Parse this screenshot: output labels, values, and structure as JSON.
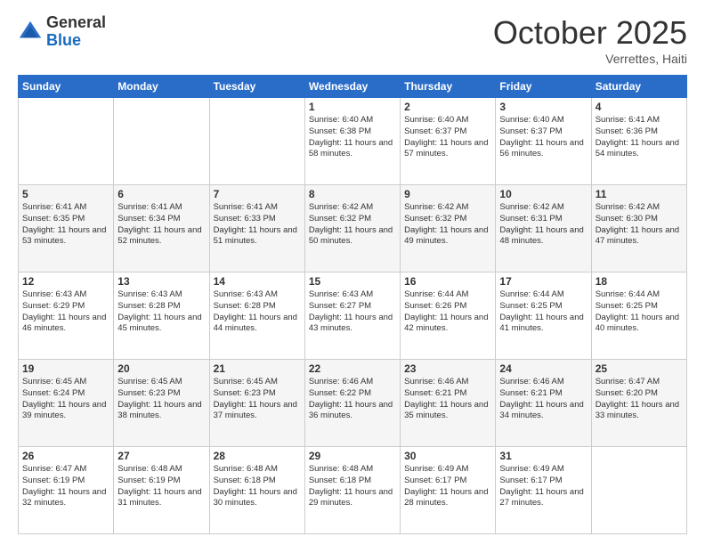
{
  "header": {
    "logo_general": "General",
    "logo_blue": "Blue",
    "month_title": "October 2025",
    "location": "Verrettes, Haiti"
  },
  "weekdays": [
    "Sunday",
    "Monday",
    "Tuesday",
    "Wednesday",
    "Thursday",
    "Friday",
    "Saturday"
  ],
  "weeks": [
    [
      {
        "day": "",
        "sunrise": "",
        "sunset": "",
        "daylight": ""
      },
      {
        "day": "",
        "sunrise": "",
        "sunset": "",
        "daylight": ""
      },
      {
        "day": "",
        "sunrise": "",
        "sunset": "",
        "daylight": ""
      },
      {
        "day": "1",
        "sunrise": "Sunrise: 6:40 AM",
        "sunset": "Sunset: 6:38 PM",
        "daylight": "Daylight: 11 hours and 58 minutes."
      },
      {
        "day": "2",
        "sunrise": "Sunrise: 6:40 AM",
        "sunset": "Sunset: 6:37 PM",
        "daylight": "Daylight: 11 hours and 57 minutes."
      },
      {
        "day": "3",
        "sunrise": "Sunrise: 6:40 AM",
        "sunset": "Sunset: 6:37 PM",
        "daylight": "Daylight: 11 hours and 56 minutes."
      },
      {
        "day": "4",
        "sunrise": "Sunrise: 6:41 AM",
        "sunset": "Sunset: 6:36 PM",
        "daylight": "Daylight: 11 hours and 54 minutes."
      }
    ],
    [
      {
        "day": "5",
        "sunrise": "Sunrise: 6:41 AM",
        "sunset": "Sunset: 6:35 PM",
        "daylight": "Daylight: 11 hours and 53 minutes."
      },
      {
        "day": "6",
        "sunrise": "Sunrise: 6:41 AM",
        "sunset": "Sunset: 6:34 PM",
        "daylight": "Daylight: 11 hours and 52 minutes."
      },
      {
        "day": "7",
        "sunrise": "Sunrise: 6:41 AM",
        "sunset": "Sunset: 6:33 PM",
        "daylight": "Daylight: 11 hours and 51 minutes."
      },
      {
        "day": "8",
        "sunrise": "Sunrise: 6:42 AM",
        "sunset": "Sunset: 6:32 PM",
        "daylight": "Daylight: 11 hours and 50 minutes."
      },
      {
        "day": "9",
        "sunrise": "Sunrise: 6:42 AM",
        "sunset": "Sunset: 6:32 PM",
        "daylight": "Daylight: 11 hours and 49 minutes."
      },
      {
        "day": "10",
        "sunrise": "Sunrise: 6:42 AM",
        "sunset": "Sunset: 6:31 PM",
        "daylight": "Daylight: 11 hours and 48 minutes."
      },
      {
        "day": "11",
        "sunrise": "Sunrise: 6:42 AM",
        "sunset": "Sunset: 6:30 PM",
        "daylight": "Daylight: 11 hours and 47 minutes."
      }
    ],
    [
      {
        "day": "12",
        "sunrise": "Sunrise: 6:43 AM",
        "sunset": "Sunset: 6:29 PM",
        "daylight": "Daylight: 11 hours and 46 minutes."
      },
      {
        "day": "13",
        "sunrise": "Sunrise: 6:43 AM",
        "sunset": "Sunset: 6:28 PM",
        "daylight": "Daylight: 11 hours and 45 minutes."
      },
      {
        "day": "14",
        "sunrise": "Sunrise: 6:43 AM",
        "sunset": "Sunset: 6:28 PM",
        "daylight": "Daylight: 11 hours and 44 minutes."
      },
      {
        "day": "15",
        "sunrise": "Sunrise: 6:43 AM",
        "sunset": "Sunset: 6:27 PM",
        "daylight": "Daylight: 11 hours and 43 minutes."
      },
      {
        "day": "16",
        "sunrise": "Sunrise: 6:44 AM",
        "sunset": "Sunset: 6:26 PM",
        "daylight": "Daylight: 11 hours and 42 minutes."
      },
      {
        "day": "17",
        "sunrise": "Sunrise: 6:44 AM",
        "sunset": "Sunset: 6:25 PM",
        "daylight": "Daylight: 11 hours and 41 minutes."
      },
      {
        "day": "18",
        "sunrise": "Sunrise: 6:44 AM",
        "sunset": "Sunset: 6:25 PM",
        "daylight": "Daylight: 11 hours and 40 minutes."
      }
    ],
    [
      {
        "day": "19",
        "sunrise": "Sunrise: 6:45 AM",
        "sunset": "Sunset: 6:24 PM",
        "daylight": "Daylight: 11 hours and 39 minutes."
      },
      {
        "day": "20",
        "sunrise": "Sunrise: 6:45 AM",
        "sunset": "Sunset: 6:23 PM",
        "daylight": "Daylight: 11 hours and 38 minutes."
      },
      {
        "day": "21",
        "sunrise": "Sunrise: 6:45 AM",
        "sunset": "Sunset: 6:23 PM",
        "daylight": "Daylight: 11 hours and 37 minutes."
      },
      {
        "day": "22",
        "sunrise": "Sunrise: 6:46 AM",
        "sunset": "Sunset: 6:22 PM",
        "daylight": "Daylight: 11 hours and 36 minutes."
      },
      {
        "day": "23",
        "sunrise": "Sunrise: 6:46 AM",
        "sunset": "Sunset: 6:21 PM",
        "daylight": "Daylight: 11 hours and 35 minutes."
      },
      {
        "day": "24",
        "sunrise": "Sunrise: 6:46 AM",
        "sunset": "Sunset: 6:21 PM",
        "daylight": "Daylight: 11 hours and 34 minutes."
      },
      {
        "day": "25",
        "sunrise": "Sunrise: 6:47 AM",
        "sunset": "Sunset: 6:20 PM",
        "daylight": "Daylight: 11 hours and 33 minutes."
      }
    ],
    [
      {
        "day": "26",
        "sunrise": "Sunrise: 6:47 AM",
        "sunset": "Sunset: 6:19 PM",
        "daylight": "Daylight: 11 hours and 32 minutes."
      },
      {
        "day": "27",
        "sunrise": "Sunrise: 6:48 AM",
        "sunset": "Sunset: 6:19 PM",
        "daylight": "Daylight: 11 hours and 31 minutes."
      },
      {
        "day": "28",
        "sunrise": "Sunrise: 6:48 AM",
        "sunset": "Sunset: 6:18 PM",
        "daylight": "Daylight: 11 hours and 30 minutes."
      },
      {
        "day": "29",
        "sunrise": "Sunrise: 6:48 AM",
        "sunset": "Sunset: 6:18 PM",
        "daylight": "Daylight: 11 hours and 29 minutes."
      },
      {
        "day": "30",
        "sunrise": "Sunrise: 6:49 AM",
        "sunset": "Sunset: 6:17 PM",
        "daylight": "Daylight: 11 hours and 28 minutes."
      },
      {
        "day": "31",
        "sunrise": "Sunrise: 6:49 AM",
        "sunset": "Sunset: 6:17 PM",
        "daylight": "Daylight: 11 hours and 27 minutes."
      },
      {
        "day": "",
        "sunrise": "",
        "sunset": "",
        "daylight": ""
      }
    ]
  ]
}
